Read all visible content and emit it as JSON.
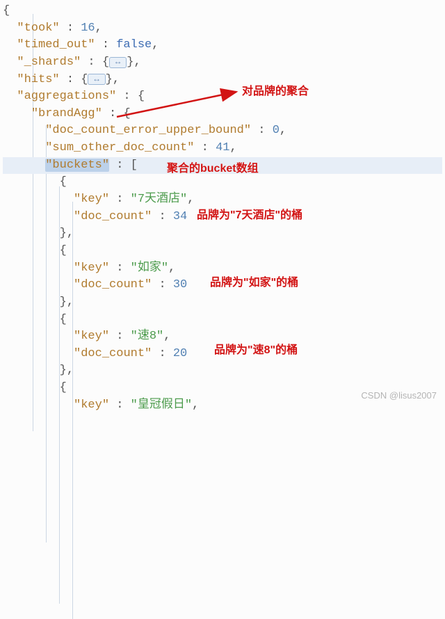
{
  "code": {
    "open": "{",
    "took_key": "\"took\"",
    "took_val": "16",
    "timed_out_key": "\"timed_out\"",
    "timed_out_val": "false",
    "shards_key": "\"_shards\"",
    "hits_key": "\"hits\"",
    "fold_glyph": "↔",
    "aggs_key": "\"aggregations\"",
    "brand_key": "\"brandAgg\"",
    "err_key": "\"doc_count_error_upper_bound\"",
    "err_val": "0",
    "sum_key": "\"sum_other_doc_count\"",
    "sum_val": "41",
    "buckets_key": "\"buckets\"",
    "bucket1_keylabel": "\"key\"",
    "bucket1_keyval": "\"7天酒店\"",
    "bucket1_cntlabel": "\"doc_count\"",
    "bucket1_cntval": "34",
    "bucket2_keylabel": "\"key\"",
    "bucket2_keyval": "\"如家\"",
    "bucket2_cntlabel": "\"doc_count\"",
    "bucket2_cntval": "30",
    "bucket3_keylabel": "\"key\"",
    "bucket3_keyval": "\"速8\"",
    "bucket3_cntlabel": "\"doc_count\"",
    "bucket3_cntval": "20",
    "bucket4_keylabel": "\"key\"",
    "bucket4_keyval": "\"皇冠假日\""
  },
  "annotations": {
    "agg_brand": "对品牌的聚合",
    "bucket_array": "聚合的bucket数组",
    "b1": "品牌为\"7天酒店\"的桶",
    "b2": "品牌为\"如家\"的桶",
    "b3": "品牌为\"速8\"的桶"
  },
  "watermark": "CSDN @lisus2007"
}
